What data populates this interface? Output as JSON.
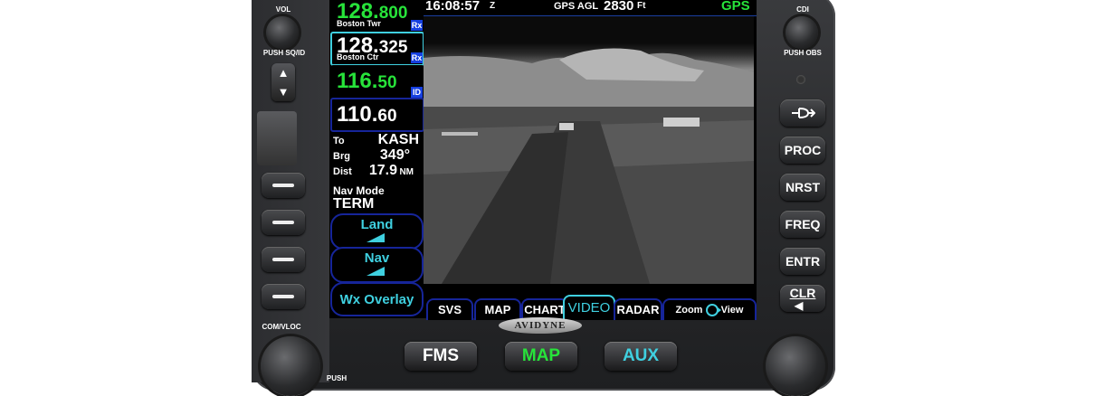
{
  "panel": {
    "vol_label": "VOL",
    "push_sq_id": "PUSH SQ/ID",
    "com_vloc": "COM/VLOC",
    "push_label": "PUSH",
    "cdi_label": "CDI",
    "push_obs": "PUSH OBS"
  },
  "freqs": {
    "com_active": {
      "int": "128.",
      "dec": "800",
      "name": "Boston Twr",
      "tag": "Rx"
    },
    "com_standby": {
      "int": "128.",
      "dec": "325",
      "name": "Boston Ctr",
      "tag": "Rx"
    },
    "nav_active": {
      "int": "116.",
      "dec": "50",
      "tag": "ID"
    },
    "nav_standby": {
      "int": "110.",
      "dec": "60"
    }
  },
  "nav_info": {
    "to_label": "To",
    "to_value": "KASH",
    "brg_label": "Brg",
    "brg_value": "349°",
    "dist_label": "Dist",
    "dist_value": "17.9",
    "dist_unit": "NM"
  },
  "nav_mode": {
    "label": "Nav Mode",
    "value": "TERM"
  },
  "side_buttons": {
    "land": "Land",
    "nav": "Nav",
    "wx_overlay": "Wx Overlay"
  },
  "topbar": {
    "time": "16:08:57",
    "time_suffix": "Z",
    "agl_label": "GPS AGL",
    "agl_value": "2830",
    "agl_unit": "Ft",
    "source": "GPS"
  },
  "tabs": [
    "SVS",
    "MAP",
    "CHART",
    "VIDEO",
    "RADAR"
  ],
  "selected_tab": "VIDEO",
  "zoom": {
    "zoom_label": "Zoom",
    "view_label": "View"
  },
  "right_buttons": {
    "direct": "-D>",
    "proc": "PROC",
    "nrst": "NRST",
    "freq": "FREQ",
    "entr": "ENTR",
    "clr": "CLR"
  },
  "bottom_buttons": {
    "fms": "FMS",
    "map": "MAP",
    "aux": "AUX"
  },
  "brand": "AVIDYNE",
  "colors": {
    "green": "#27e33a",
    "cyan": "#3fd0e0",
    "blue_frame": "#16259a",
    "tag_blue": "#1640e0",
    "gps_green": "#27e33a"
  }
}
